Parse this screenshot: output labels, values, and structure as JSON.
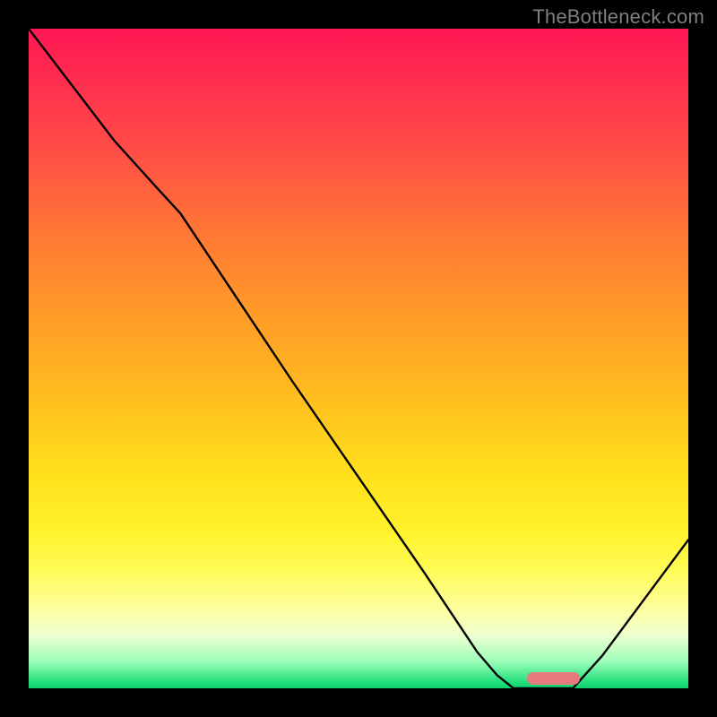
{
  "watermark": "TheBottleneck.com",
  "chart_data": {
    "type": "line",
    "title": "",
    "xlabel": "",
    "ylabel": "",
    "xlim": [
      0,
      1
    ],
    "ylim": [
      0,
      1
    ],
    "grid": false,
    "curve_points": [
      {
        "x": 0.0,
        "y": 1.0
      },
      {
        "x": 0.13,
        "y": 0.83
      },
      {
        "x": 0.195,
        "y": 0.758
      },
      {
        "x": 0.23,
        "y": 0.72
      },
      {
        "x": 0.3,
        "y": 0.615
      },
      {
        "x": 0.4,
        "y": 0.465
      },
      {
        "x": 0.5,
        "y": 0.32
      },
      {
        "x": 0.6,
        "y": 0.175
      },
      {
        "x": 0.68,
        "y": 0.055
      },
      {
        "x": 0.71,
        "y": 0.02
      },
      {
        "x": 0.735,
        "y": 0.0
      },
      {
        "x": 0.825,
        "y": 0.0
      },
      {
        "x": 0.87,
        "y": 0.05
      },
      {
        "x": 1.0,
        "y": 0.225
      }
    ],
    "marker": {
      "x_start": 0.755,
      "x_end": 0.835,
      "y": 0.008,
      "color": "#e77a7f"
    },
    "gradient_stops": [
      {
        "offset": 0.0,
        "color": "#ff1754"
      },
      {
        "offset": 0.08,
        "color": "#ff2e4f"
      },
      {
        "offset": 0.2,
        "color": "#ff5244"
      },
      {
        "offset": 0.3,
        "color": "#ff7436"
      },
      {
        "offset": 0.42,
        "color": "#ff972a"
      },
      {
        "offset": 0.55,
        "color": "#ffbb1f"
      },
      {
        "offset": 0.68,
        "color": "#ffe11c"
      },
      {
        "offset": 0.76,
        "color": "#fff22a"
      },
      {
        "offset": 0.82,
        "color": "#fffb56"
      },
      {
        "offset": 0.88,
        "color": "#fdffa0"
      },
      {
        "offset": 0.92,
        "color": "#eeffd0"
      },
      {
        "offset": 0.96,
        "color": "#9bfdb9"
      },
      {
        "offset": 0.99,
        "color": "#24e07c"
      },
      {
        "offset": 1.0,
        "color": "#0ecf6d"
      }
    ]
  }
}
